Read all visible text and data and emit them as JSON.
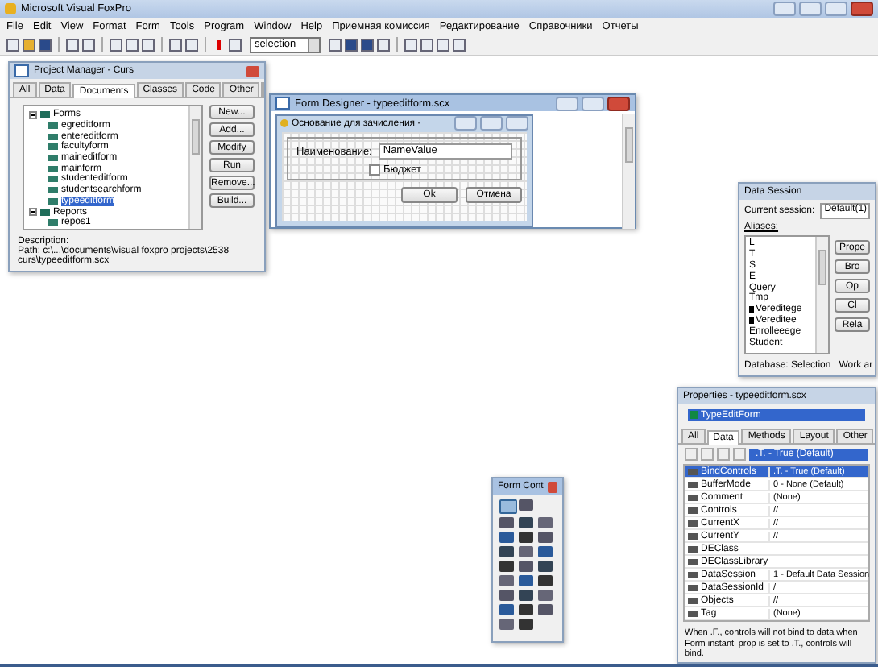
{
  "window": {
    "title": "Microsoft Visual FoxPro"
  },
  "menu": [
    "File",
    "Edit",
    "View",
    "Format",
    "Form",
    "Tools",
    "Program",
    "Window",
    "Help",
    "Приемная комиссия",
    "Редактирование",
    "Справочники",
    "Отчеты"
  ],
  "toolbar": {
    "selection": "selection"
  },
  "project_manager": {
    "title": "Project Manager - Curs",
    "tabs": [
      {
        "label": "All",
        "selected": false
      },
      {
        "label": "Data",
        "selected": false
      },
      {
        "label": "Documents",
        "selected": true
      },
      {
        "label": "Classes",
        "selected": false
      },
      {
        "label": "Code",
        "selected": false
      },
      {
        "label": "Other",
        "selected": false
      }
    ],
    "tree": [
      {
        "label": "Forms",
        "expanded": true,
        "children": [
          {
            "label": "egreditform",
            "selected": false
          },
          {
            "label": "entereditform",
            "selected": false
          },
          {
            "label": "facultyform",
            "selected": false
          },
          {
            "label": "maineditform",
            "selected": false
          },
          {
            "label": "mainform",
            "selected": false
          },
          {
            "label": "studenteditform",
            "selected": false
          },
          {
            "label": "studentsearchform",
            "selected": false
          },
          {
            "label": "typeeditform",
            "selected": true
          }
        ]
      },
      {
        "label": "Reports",
        "expanded": true,
        "children": [
          {
            "label": "repos1",
            "selected": false
          }
        ]
      }
    ],
    "buttons": [
      "New...",
      "Add...",
      "Modify",
      "Run",
      "Remove...",
      "Build..."
    ],
    "description_label": "Description:",
    "path": "Path: c:\\...\\documents\\visual foxpro projects\\2538 curs\\typeeditform.scx"
  },
  "form_designer": {
    "title": "Form Designer - typeeditform.scx",
    "form_title": "Основание для зачисления -",
    "field_label": "Наименование:",
    "field_value": "NameValue",
    "checkbox": {
      "label": "Бюджет",
      "checked": false
    },
    "buttons": [
      "Ok",
      "Отмена"
    ]
  },
  "data_session": {
    "title": "Data Session",
    "current_session_label": "Current session:",
    "current_session": "Default(1)",
    "aliases_label": "Aliases:",
    "aliases": [
      {
        "label": "L",
        "related": false
      },
      {
        "label": "T",
        "related": false
      },
      {
        "label": "S",
        "related": false
      },
      {
        "label": "E",
        "related": false
      },
      {
        "label": "Query",
        "related": false
      },
      {
        "label": "Tmp",
        "related": false
      },
      {
        "label": "Vereditege",
        "related": true
      },
      {
        "label": "Vereditee",
        "related": true
      },
      {
        "label": "Enrolleeege",
        "related": false
      },
      {
        "label": "Student",
        "related": false
      }
    ],
    "buttons": [
      "Prope",
      "Bro",
      "Op",
      "Cl",
      "Rela"
    ],
    "status": [
      "Database: Selection",
      "Work ar"
    ]
  },
  "properties": {
    "title": "Properties - typeeditform.scx",
    "object": "TypeEditForm",
    "tabs": [
      {
        "label": "All",
        "selected": false
      },
      {
        "label": "Data",
        "selected": true
      },
      {
        "label": "Methods",
        "selected": false
      },
      {
        "label": "Layout",
        "selected": false
      },
      {
        "label": "Other",
        "selected": false
      }
    ],
    "value_box": ".T. - True (Default)",
    "rows": [
      {
        "name": "BindControls",
        "value": ".T. - True (Default)",
        "selected": true
      },
      {
        "name": "BufferMode",
        "value": "0 - None (Default)",
        "selected": false
      },
      {
        "name": "Comment",
        "value": "(None)",
        "selected": false
      },
      {
        "name": "Controls",
        "value": "//",
        "selected": false
      },
      {
        "name": "CurrentX",
        "value": "//",
        "selected": false
      },
      {
        "name": "CurrentY",
        "value": "//",
        "selected": false
      },
      {
        "name": "DEClass",
        "selected": false
      },
      {
        "name": "DEClassLibrary",
        "selected": false
      },
      {
        "name": "DataSession",
        "value": "1 - Default Data Session",
        "selected": false
      },
      {
        "name": "DataSessionId",
        "value": "/",
        "selected": false
      },
      {
        "name": "Objects",
        "value": "//",
        "selected": false
      },
      {
        "name": "Tag",
        "value": "(None)",
        "selected": false
      }
    ],
    "description": "When .F., controls will not bind to data when Form instanti prop is set to .T., controls will bind."
  },
  "form_controls": {
    "title": "Form Cont"
  }
}
